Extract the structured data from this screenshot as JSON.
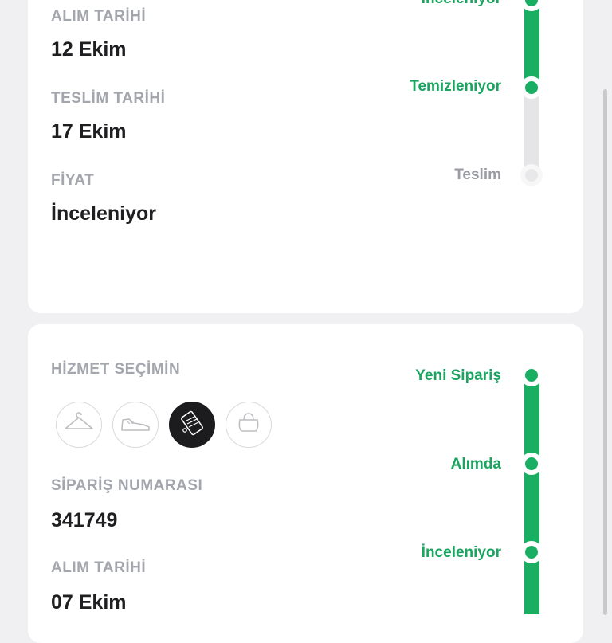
{
  "card1": {
    "fields": [
      {
        "label": "ALIM TARİHİ",
        "value": "12 Ekim"
      },
      {
        "label": "TESLİM TARİHİ",
        "value": "17 Ekim"
      },
      {
        "label": "FİYAT",
        "value": "İnceleniyor"
      }
    ],
    "timeline": [
      {
        "label": "İnceleniyor",
        "status": "done"
      },
      {
        "label": "Temizleniyor",
        "status": "done"
      },
      {
        "label": "Teslim",
        "status": "pending"
      }
    ]
  },
  "card2": {
    "service_label": "HİZMET SEÇİMİN",
    "services": [
      {
        "icon": "hanger-icon",
        "selected": false
      },
      {
        "icon": "sneaker-icon",
        "selected": false
      },
      {
        "icon": "pattern-cloth-icon",
        "selected": true
      },
      {
        "icon": "bag-icon",
        "selected": false
      }
    ],
    "fields": [
      {
        "label": "SİPARİŞ NUMARASI",
        "value": "341749"
      },
      {
        "label": "ALIM TARİHİ",
        "value": "07 Ekim"
      }
    ],
    "timeline": [
      {
        "label": "Yeni Sipariş",
        "status": "done"
      },
      {
        "label": "Alımda",
        "status": "done"
      },
      {
        "label": "İnceleniyor",
        "status": "done"
      }
    ]
  },
  "colors": {
    "accent_green": "#1aae63",
    "label_gray": "#a3a6ad",
    "value_dark": "#1f1f22",
    "background": "#f0f0f2"
  }
}
